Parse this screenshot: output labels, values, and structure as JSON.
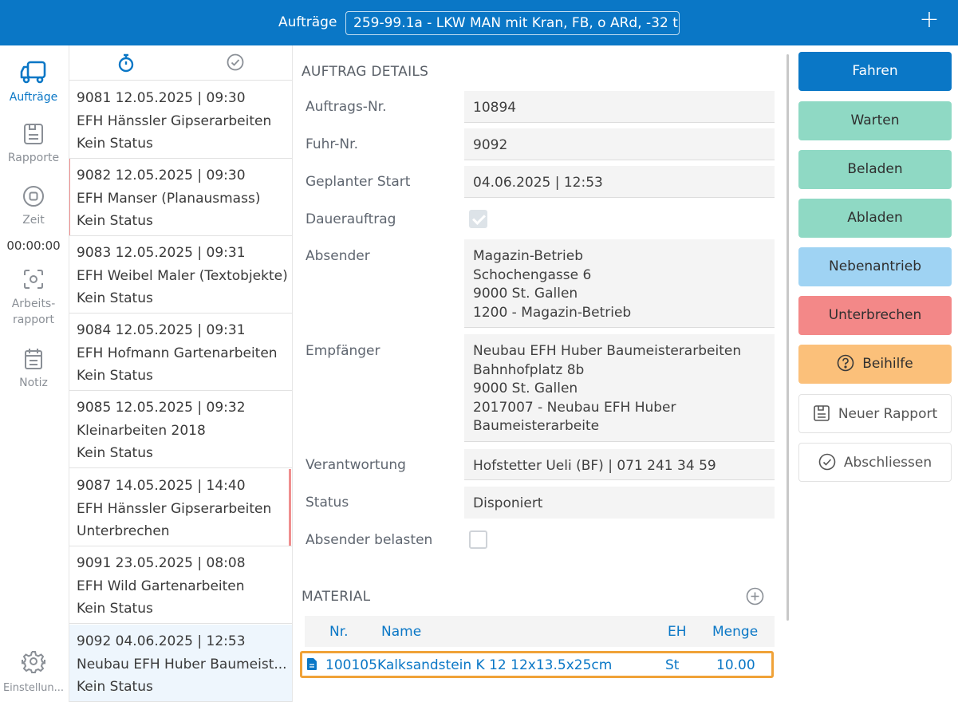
{
  "topbar": {
    "title": "Aufträge",
    "vehicle": "259-99.1a - LKW MAN mit Kran, FB, o ARd, -32 t",
    "add_label": "+"
  },
  "nav": {
    "orders": "Aufträge",
    "reports": "Rapporte",
    "time": "Zeit",
    "time_value": "00:00:00",
    "work_report_1": "Arbeits-",
    "work_report_2": "rapport",
    "note": "Notiz",
    "settings": "Einstellun..."
  },
  "orders": [
    {
      "line1": "9081  12.05.2025 | 09:30",
      "line2": "EFH Hänssler Gipserarbeiten",
      "line3": "Kein Status"
    },
    {
      "line1": "9082  12.05.2025 | 09:30",
      "line2": "EFH Manser (Planausmass)",
      "line3": "Kein Status"
    },
    {
      "line1": "9083  12.05.2025 | 09:31",
      "line2": "EFH Weibel Maler (Textobjekte)",
      "line3": "Kein Status"
    },
    {
      "line1": "9084  12.05.2025 | 09:31",
      "line2": "EFH Hofmann Gartenarbeiten",
      "line3": "Kein Status"
    },
    {
      "line1": "9085  12.05.2025 | 09:32",
      "line2": "Kleinarbeiten 2018",
      "line3": "Kein Status"
    },
    {
      "line1": "9087  14.05.2025 | 14:40",
      "line2": "EFH Hänssler Gipserarbeiten",
      "line3": "Unterbrechen"
    },
    {
      "line1": "9091  23.05.2025 | 08:08",
      "line2": "EFH Wild Gartenarbeiten",
      "line3": "Kein Status"
    },
    {
      "line1": "9092  04.06.2025 | 12:53",
      "line2": "Neubau EFH Huber Baumeist...",
      "line3": "Kein Status"
    }
  ],
  "details": {
    "section_title": "AUFTRAG DETAILS",
    "labels": {
      "order_no": "Auftrags-Nr.",
      "trip_no": "Fuhr-Nr.",
      "planned_start": "Geplanter Start",
      "standing_order": "Dauerauftrag",
      "sender": "Absender",
      "recipient": "Empfänger",
      "responsible": "Verantwortung",
      "status": "Status",
      "charge_sender": "Absender belasten"
    },
    "values": {
      "order_no": "10894",
      "trip_no": "9092",
      "planned_start": "04.06.2025 | 12:53",
      "standing_order_checked": true,
      "sender_1": "Magazin-Betrieb",
      "sender_2": "Schochengasse 6",
      "sender_3": "9000 St. Gallen",
      "sender_4": "1200 - Magazin-Betrieb",
      "recipient_1": "Neubau EFH Huber Baumeisterarbeiten",
      "recipient_2": "Bahnhofplatz 8b",
      "recipient_3": "9000 St. Gallen",
      "recipient_4": "2017007 - Neubau EFH Huber",
      "recipient_5": "Baumeisterarbeite",
      "responsible": "Hofstetter Ueli (BF) | 071 241 34 59",
      "status": "Disponiert",
      "charge_sender_checked": false
    }
  },
  "material": {
    "title": "MATERIAL",
    "headers": {
      "nr": "Nr.",
      "name": "Name",
      "unit": "EH",
      "qty": "Menge"
    },
    "rows": [
      {
        "nr": "100105",
        "name": "Kalksandstein K 12 12x13.5x25cm",
        "unit": "St",
        "qty": "10.00"
      }
    ]
  },
  "actions": {
    "drive": "Fahren",
    "wait": "Warten",
    "load": "Beladen",
    "unload": "Abladen",
    "pto": "Nebenantrieb",
    "interrupt": "Unterbrechen",
    "assist": "Beihilfe",
    "new_report": "Neuer Rapport",
    "complete": "Abschliessen"
  },
  "colors": {
    "primary": "#0a77c6",
    "green": "#8fd9c4",
    "light_blue": "#9fd3f3",
    "red": "#f38888",
    "orange": "#fbc07a",
    "highlight": "#f0a238"
  }
}
